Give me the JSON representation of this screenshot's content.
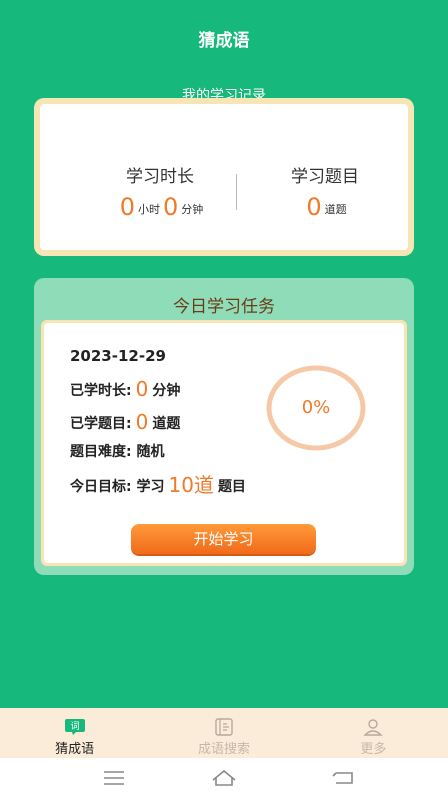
{
  "header": {
    "title": "猜成语"
  },
  "record": {
    "caption": "我的学习记录",
    "time": {
      "title": "学习时长",
      "hours": "0",
      "hours_unit": "小时",
      "minutes": "0",
      "minutes_unit": "分钟"
    },
    "questions": {
      "title": "学习题目",
      "count": "0",
      "unit": "道题"
    }
  },
  "task": {
    "title": "今日学习任务",
    "date": "2023-12-29",
    "learned_time": {
      "label": "已学时长:",
      "value": "0",
      "unit": "分钟"
    },
    "learned_questions": {
      "label": "已学题目:",
      "value": "0",
      "unit": "道题"
    },
    "difficulty": {
      "label": "题目难度:",
      "value": "随机"
    },
    "goal": {
      "label": "今日目标:",
      "prefix": "学习",
      "value": "10道",
      "suffix": "题目"
    },
    "progress": "0%",
    "progress_fraction": 0,
    "start_button": "开始学习"
  },
  "nav": {
    "items": [
      {
        "label": "猜成语",
        "icon": "chat-bubble-icon",
        "active": true,
        "badge": "词"
      },
      {
        "label": "成语搜索",
        "icon": "book-search-icon",
        "active": false
      },
      {
        "label": "更多",
        "icon": "person-icon",
        "active": false
      }
    ]
  },
  "system_bar": {
    "icons": [
      "menu-icon",
      "home-icon",
      "back-icon"
    ]
  },
  "colors": {
    "background": "#17b87b",
    "accent": "#f07a2a",
    "card_border": "#f6e6b6",
    "task_card": "#8fdcb8",
    "nav_bg": "#fbecd9"
  }
}
